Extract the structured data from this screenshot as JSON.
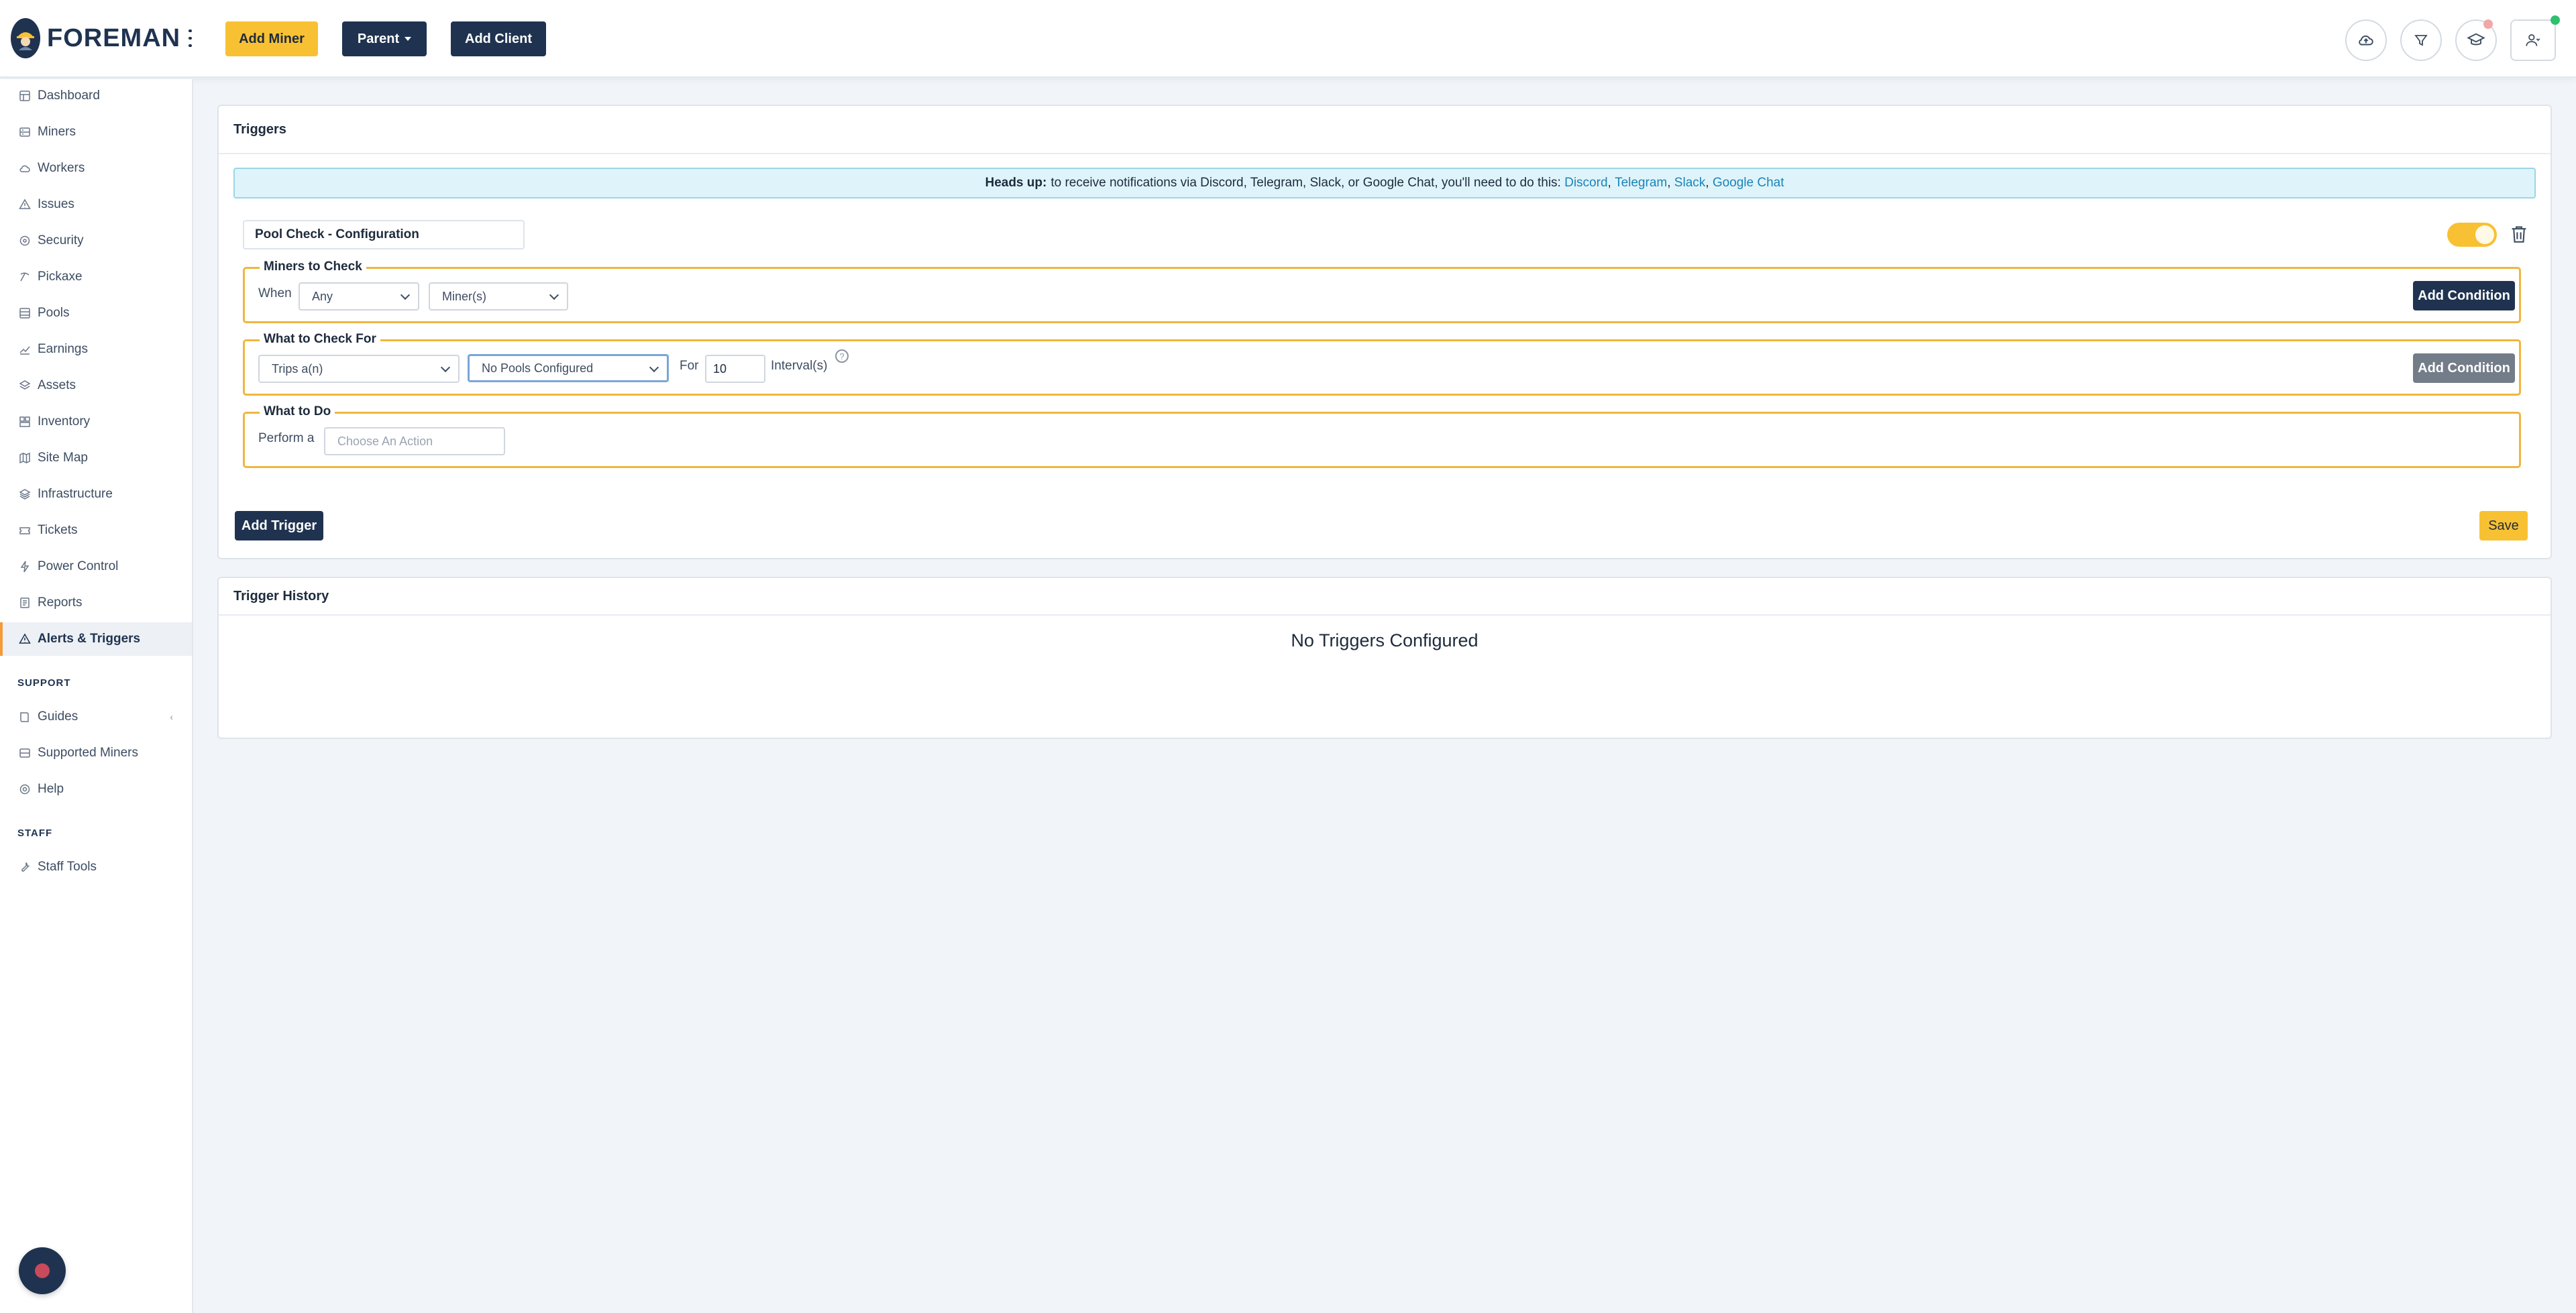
{
  "app": {
    "brand": "FOREMAN",
    "accent": "#f8c133",
    "navy": "#1f3350"
  },
  "topbar": {
    "add_miner": "Add Miner",
    "parent": "Parent",
    "add_client": "Add Client",
    "icons": [
      "cloud-upload-icon",
      "filter-icon",
      "graduation-cap-icon",
      "user-icon"
    ]
  },
  "sidebar": {
    "items": [
      {
        "label": "Dashboard",
        "icon": "dashboard-icon"
      },
      {
        "label": "Miners",
        "icon": "server-icon"
      },
      {
        "label": "Workers",
        "icon": "cloud-icon"
      },
      {
        "label": "Issues",
        "icon": "warning-icon"
      },
      {
        "label": "Security",
        "icon": "lock-icon"
      },
      {
        "label": "Pickaxe",
        "icon": "pickaxe-icon"
      },
      {
        "label": "Pools",
        "icon": "pool-icon"
      },
      {
        "label": "Earnings",
        "icon": "earnings-icon"
      },
      {
        "label": "Assets",
        "icon": "assets-icon"
      },
      {
        "label": "Inventory",
        "icon": "inventory-icon"
      },
      {
        "label": "Site Map",
        "icon": "map-icon"
      },
      {
        "label": "Infrastructure",
        "icon": "layers-icon"
      },
      {
        "label": "Tickets",
        "icon": "ticket-icon"
      },
      {
        "label": "Power Control",
        "icon": "bolt-icon"
      },
      {
        "label": "Reports",
        "icon": "report-icon"
      },
      {
        "label": "Alerts & Triggers",
        "icon": "alert-icon"
      }
    ],
    "support_heading": "SUPPORT",
    "support_items": [
      {
        "label": "Guides",
        "icon": "book-icon"
      },
      {
        "label": "Supported Miners",
        "icon": "server-icon"
      },
      {
        "label": "Help",
        "icon": "help-icon"
      }
    ],
    "staff_heading": "STAFF",
    "staff_items": [
      {
        "label": "Staff Tools",
        "icon": "tools-icon"
      }
    ]
  },
  "triggers": {
    "title": "Triggers",
    "alert": {
      "bold": "Heads up:",
      "text": "to receive notifications via Discord, Telegram, Slack, or Google Chat, you'll need to do this:",
      "links": [
        "Discord",
        "Telegram",
        "Slack",
        "Google Chat"
      ],
      "sep": ","
    },
    "trigger_name": "Pool Check - Configuration",
    "enabled": true,
    "miners_to_check": {
      "legend": "Miners to Check",
      "when_label": "When",
      "quantifier": "Any",
      "target": "Miner(s)",
      "add_condition": "Add Condition"
    },
    "what_to_check": {
      "legend": "What to Check For",
      "check_type": "Trips a(n)",
      "check_value": "No Pools Configured",
      "for_label": "For",
      "interval_value": "10",
      "interval_label": "Interval(s)",
      "help": "?",
      "add_condition": "Add Condition"
    },
    "what_to_do": {
      "legend": "What to Do",
      "perform_label": "Perform a",
      "action_placeholder": "Choose An Action"
    },
    "add_trigger": "Add Trigger",
    "save": "Save"
  },
  "history": {
    "title": "Trigger History",
    "empty": "No Triggers Configured"
  }
}
